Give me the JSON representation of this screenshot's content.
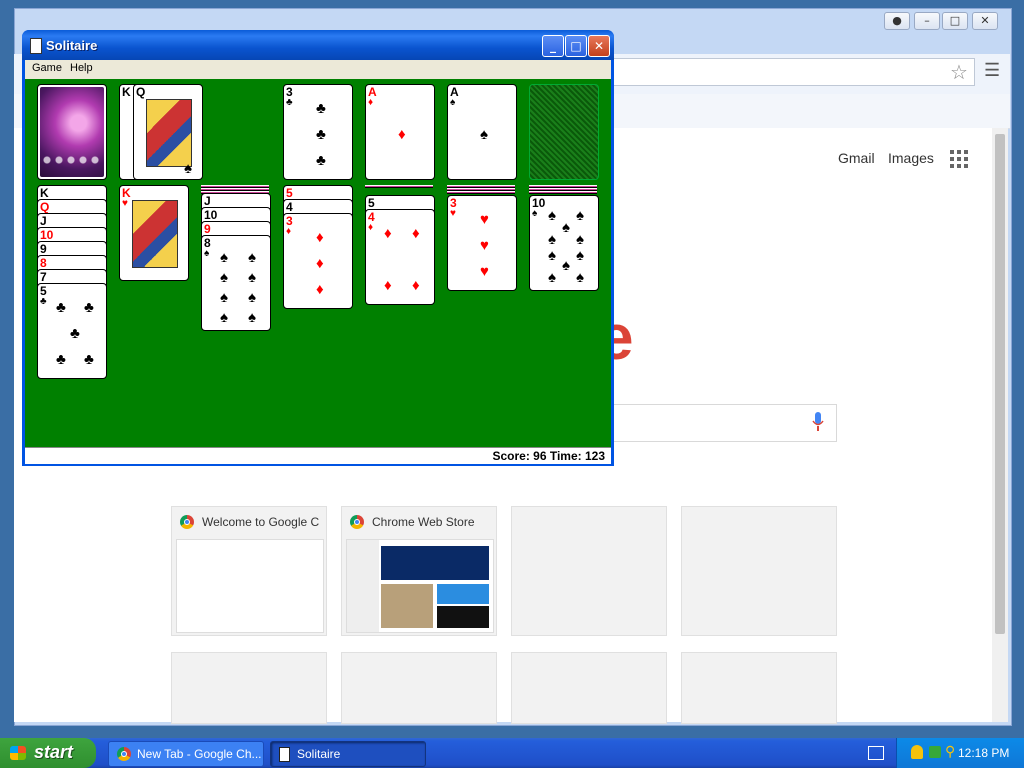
{
  "chrome": {
    "links": {
      "gmail": "Gmail",
      "images": "Images"
    },
    "logo_tail": "e",
    "tiles": [
      {
        "title": "Welcome to Google C"
      },
      {
        "title": "Chrome Web Store"
      }
    ]
  },
  "solitaire": {
    "title": "Solitaire",
    "menu": [
      "Game",
      "Help"
    ],
    "status": "Score: 96 Time: 123",
    "top_row": {
      "waste": [
        "K",
        "Q"
      ],
      "foundations": [
        {
          "rank": "3",
          "suit": "♣",
          "color": "blk"
        },
        {
          "rank": "A",
          "suit": "♦",
          "color": "red"
        },
        {
          "rank": "A",
          "suit": "♠",
          "color": "blk"
        }
      ]
    },
    "tableau": [
      {
        "stack": [
          [
            "K",
            "♠",
            "blk"
          ],
          [
            "Q",
            "♥",
            "red"
          ],
          [
            "J",
            "♠",
            "blk"
          ],
          [
            "10",
            "♥",
            "red"
          ],
          [
            "9",
            "♠",
            "blk"
          ],
          [
            "8",
            "♥",
            "red"
          ],
          [
            "7",
            "♠",
            "blk"
          ]
        ],
        "top": {
          "rank": "5",
          "suit": "♣",
          "color": "blk"
        }
      },
      {
        "stack": [],
        "top": {
          "rank": "K",
          "suit": "♥",
          "color": "red"
        }
      },
      {
        "stack": [
          [
            "J",
            "♠",
            "blk"
          ],
          [
            "10",
            "♠",
            "blk"
          ],
          [
            "9",
            "♥",
            "red"
          ]
        ],
        "top": {
          "rank": "8",
          "suit": "♠",
          "color": "blk"
        }
      },
      {
        "stack": [
          [
            "5",
            "♥",
            "red"
          ],
          [
            "4",
            "♠",
            "blk"
          ]
        ],
        "top": {
          "rank": "3",
          "suit": "♦",
          "color": "red"
        }
      },
      {
        "stack": [
          [
            "5",
            "♠",
            "blk"
          ]
        ],
        "top": {
          "rank": "4",
          "suit": "♦",
          "color": "red"
        }
      },
      {
        "stack": [],
        "top": {
          "rank": "3",
          "suit": "♥",
          "color": "red"
        }
      },
      {
        "stack": [],
        "top": {
          "rank": "10",
          "suit": "♠",
          "color": "blk"
        }
      }
    ]
  },
  "taskbar": {
    "start": "start",
    "tasks": [
      "New Tab - Google Ch...",
      "Solitaire"
    ],
    "clock": "12:18 PM"
  }
}
